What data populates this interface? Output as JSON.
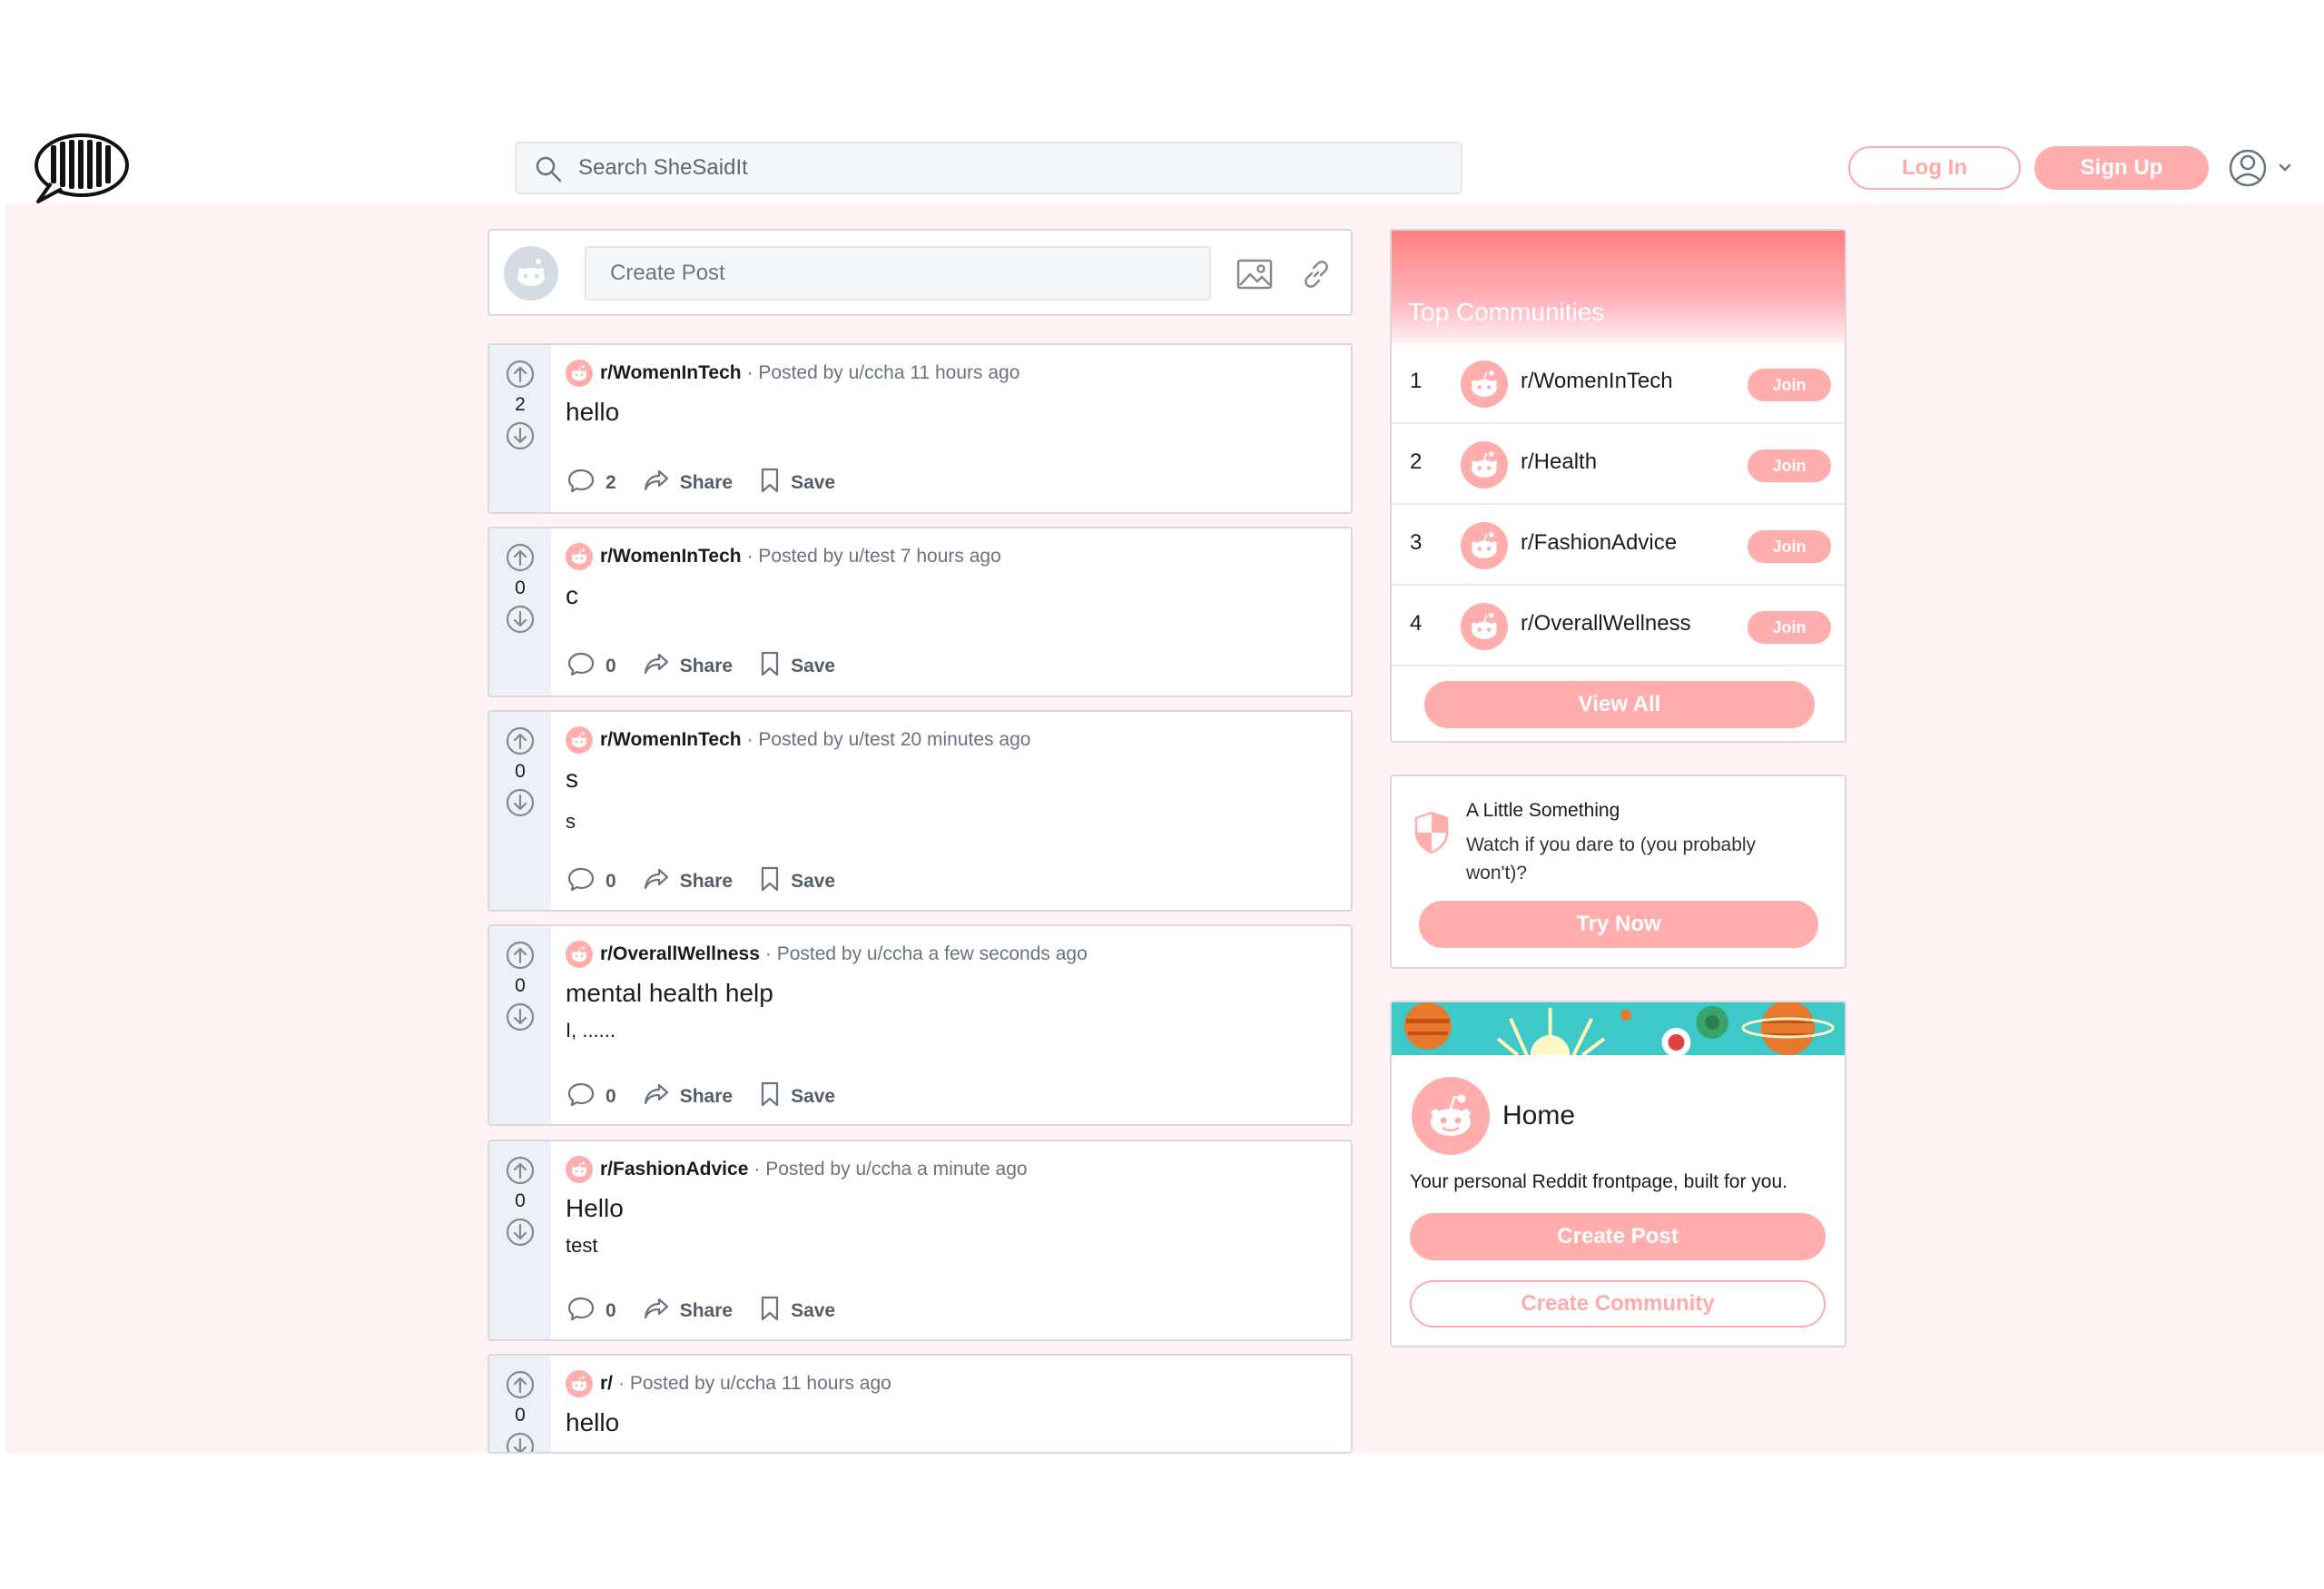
{
  "header": {
    "logo_alt": "She Said It",
    "search_placeholder": "Search SheSaidIt",
    "login_label": "Log In",
    "signup_label": "Sign Up"
  },
  "colors": {
    "accent": "#ffadad",
    "background": "#fff3f5",
    "vote_column": "#edf1f7"
  },
  "create_post": {
    "placeholder": "Create Post"
  },
  "posts": [
    {
      "subreddit": "r/WomenInTech",
      "meta": "· Posted by u/ccha 11 hours ago",
      "title": "hello",
      "body": "",
      "votes": "2",
      "comments": "2",
      "share": "Share",
      "save": "Save"
    },
    {
      "subreddit": "r/WomenInTech",
      "meta": "· Posted by u/test 7 hours ago",
      "title": "c",
      "body": "",
      "votes": "0",
      "comments": "0",
      "share": "Share",
      "save": "Save"
    },
    {
      "subreddit": "r/WomenInTech",
      "meta": "· Posted by u/test 20 minutes ago",
      "title": "s",
      "body": "s",
      "votes": "0",
      "comments": "0",
      "share": "Share",
      "save": "Save"
    },
    {
      "subreddit": "r/OverallWellness",
      "meta": "· Posted by u/ccha a few seconds ago",
      "title": "mental health help",
      "body": "I, ......",
      "votes": "0",
      "comments": "0",
      "share": "Share",
      "save": "Save"
    },
    {
      "subreddit": "r/FashionAdvice",
      "meta": "· Posted by u/ccha a minute ago",
      "title": "Hello",
      "body": "test",
      "votes": "0",
      "comments": "0",
      "share": "Share",
      "save": "Save"
    },
    {
      "subreddit": "r/",
      "meta": "· Posted by u/ccha 11 hours ago",
      "title": "hello",
      "body": "",
      "votes": "0",
      "comments": "",
      "share": "",
      "save": ""
    }
  ],
  "top_communities": {
    "title": "Top Communities",
    "items": [
      {
        "rank": "1",
        "name": "r/WomenInTech",
        "join": "Join"
      },
      {
        "rank": "2",
        "name": "r/Health",
        "join": "Join"
      },
      {
        "rank": "3",
        "name": "r/FashionAdvice",
        "join": "Join"
      },
      {
        "rank": "4",
        "name": "r/OverallWellness",
        "join": "Join"
      }
    ],
    "view_all": "View All"
  },
  "little_something": {
    "title": "A Little Something",
    "text": "Watch if you dare to (you probably won't)?",
    "button": "Try Now"
  },
  "home": {
    "title": "Home",
    "description": "Your personal Reddit frontpage, built for you.",
    "create_post": "Create Post",
    "create_community": "Create Community"
  }
}
